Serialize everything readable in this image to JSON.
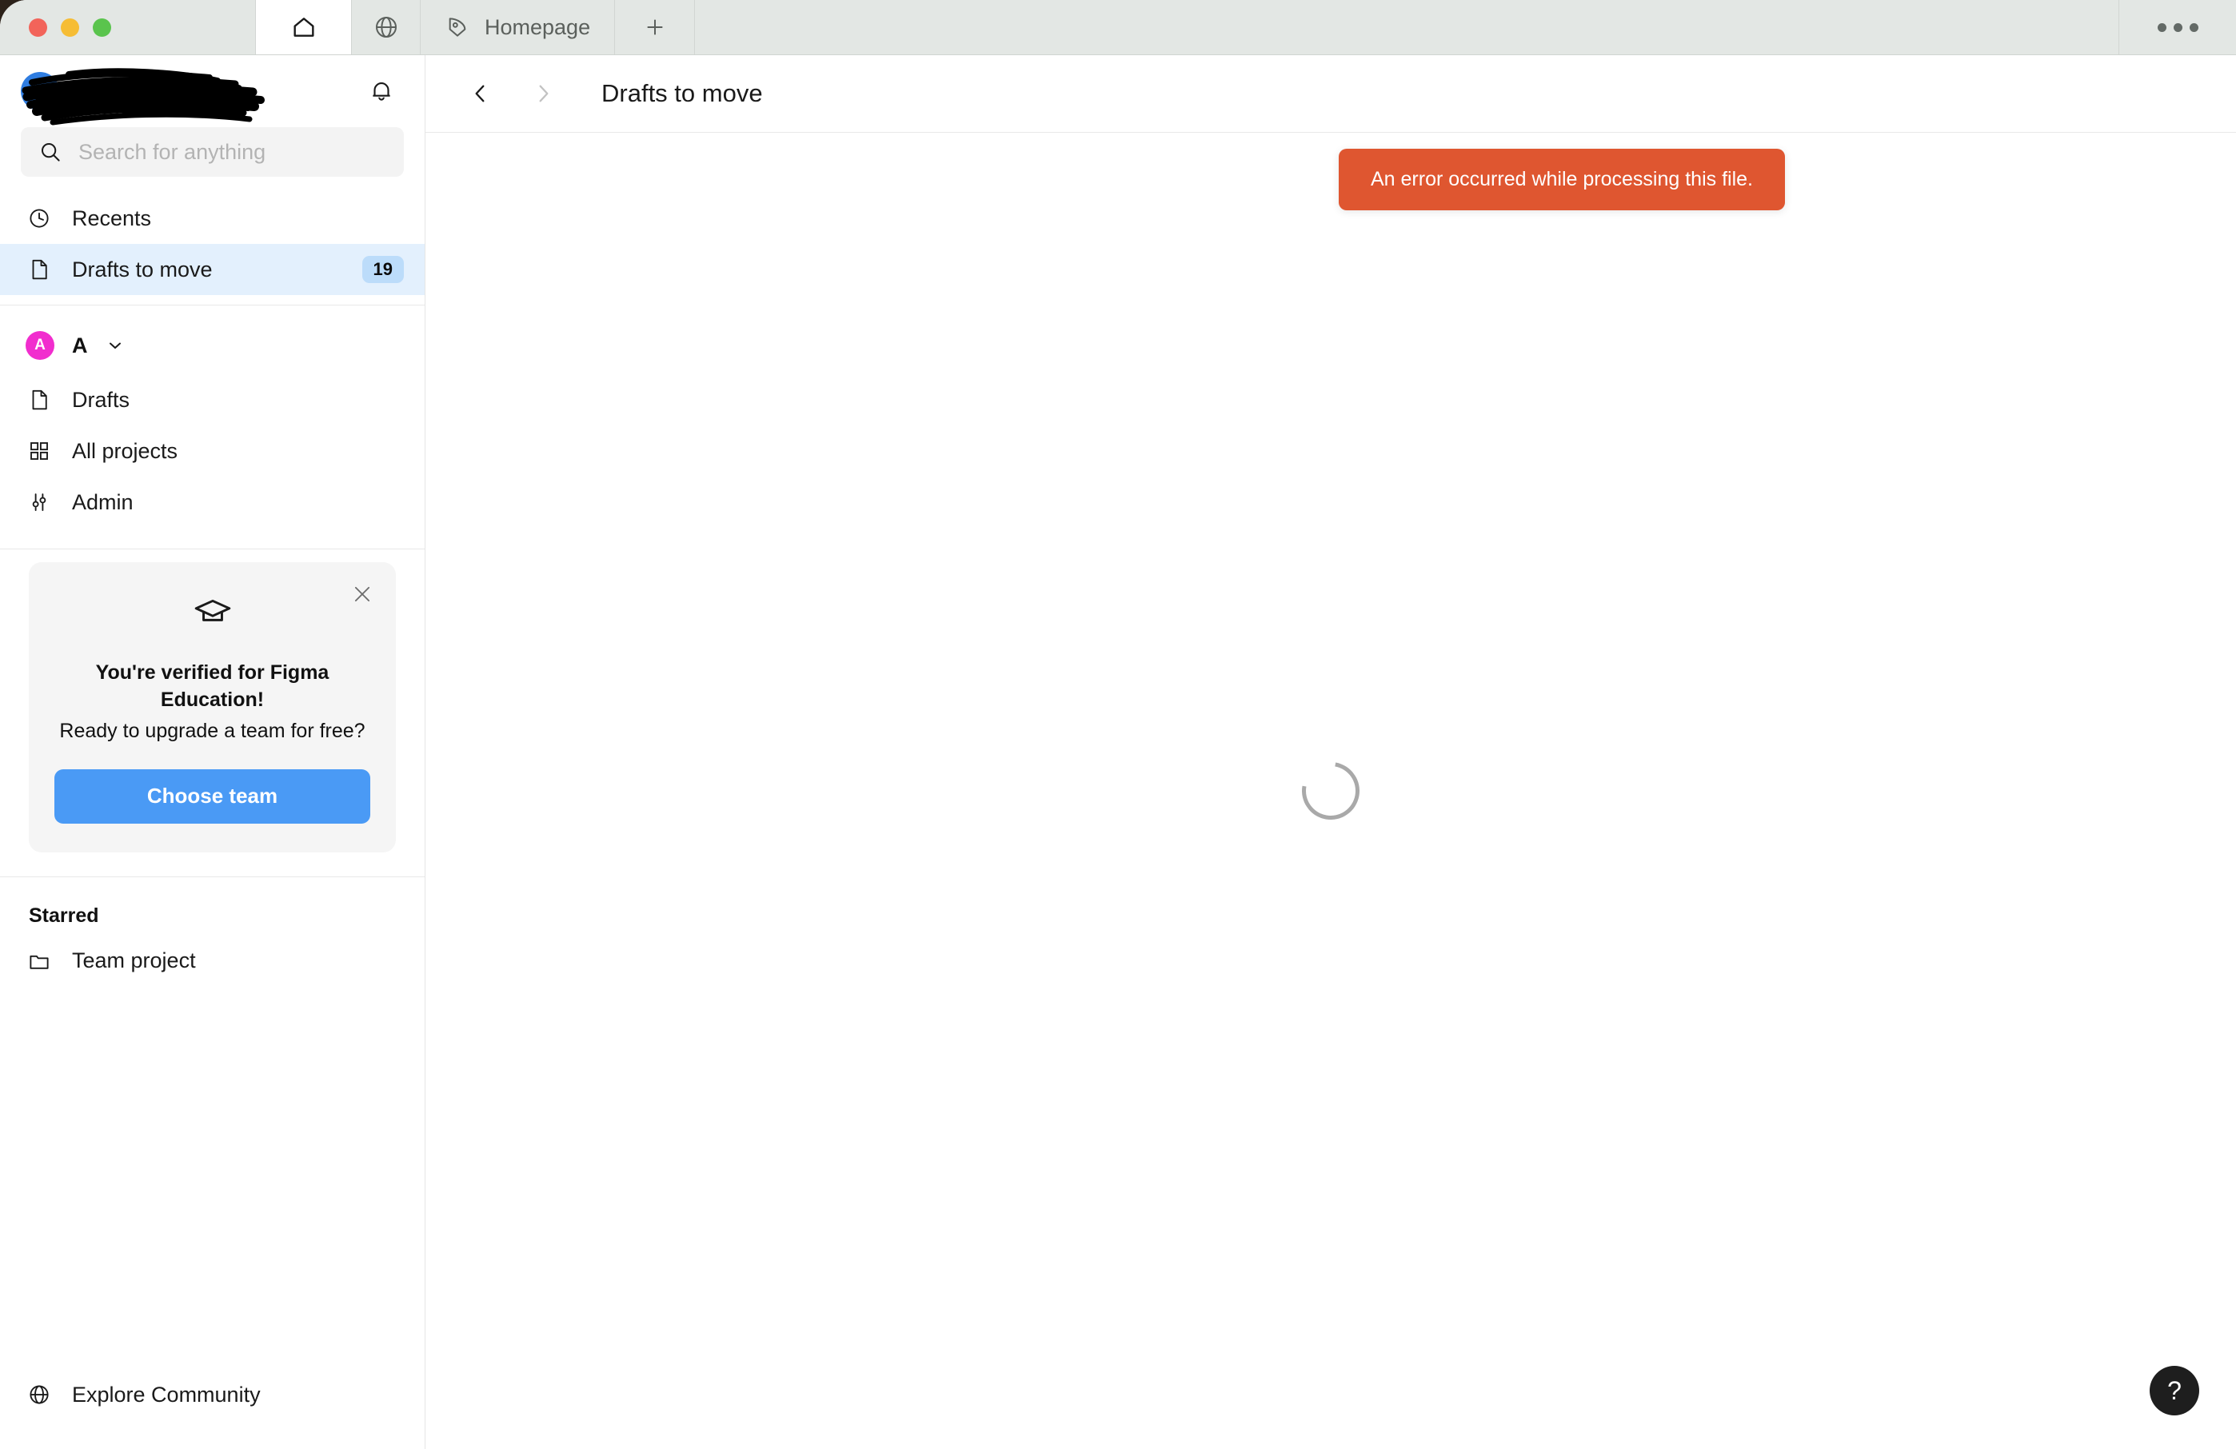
{
  "window": {
    "traffic_lights": [
      "close",
      "minimize",
      "maximize"
    ],
    "menu_label": "···",
    "tabs": [
      {
        "name": "home",
        "label": "",
        "icon": "home-icon",
        "active": true
      },
      {
        "name": "community",
        "label": "",
        "icon": "globe-icon",
        "active": false
      },
      {
        "name": "homepage",
        "label": "Homepage",
        "icon": "figma-pen-icon",
        "active": false
      }
    ],
    "new_tab_label": "+"
  },
  "sidebar": {
    "account": {
      "name": "",
      "redacted": true,
      "avatar_color": "#2f7de1"
    },
    "notifications_icon": "bell-icon",
    "search": {
      "placeholder": "Search for anything",
      "value": "",
      "icon": "search-icon"
    },
    "nav": [
      {
        "label": "Recents",
        "icon": "clock-icon",
        "badge": "",
        "selected": false
      },
      {
        "label": "Drafts to move",
        "icon": "file-icon",
        "badge": "19",
        "selected": true
      }
    ],
    "team": {
      "avatar_letter": "A",
      "avatar_color": "#f12dce",
      "name": "A",
      "chevron": "chevron-down-icon",
      "items": [
        {
          "label": "Drafts",
          "icon": "file-icon"
        },
        {
          "label": "All projects",
          "icon": "grid-icon"
        },
        {
          "label": "Admin",
          "icon": "sliders-icon"
        }
      ]
    },
    "education_card": {
      "icon": "graduation-cap-icon",
      "close_icon": "close-icon",
      "title": "You're verified for Figma Education!",
      "subtitle": "Ready to upgrade a team for free?",
      "button_label": "Choose team",
      "button_color": "#4a9af5"
    },
    "starred": {
      "title": "Starred",
      "items": [
        {
          "label": "Team project",
          "icon": "folder-icon"
        }
      ]
    },
    "footer": {
      "label": "Explore Community",
      "icon": "globe-icon"
    }
  },
  "main": {
    "back_label": "",
    "forward_label": "",
    "back_icon": "chevron-left-icon",
    "forward_icon": "chevron-right-icon",
    "title": "Drafts to move",
    "toast": {
      "message": "An error occurred while processing this file.",
      "color": "#df5630"
    },
    "loading": true,
    "help_label": "?"
  }
}
